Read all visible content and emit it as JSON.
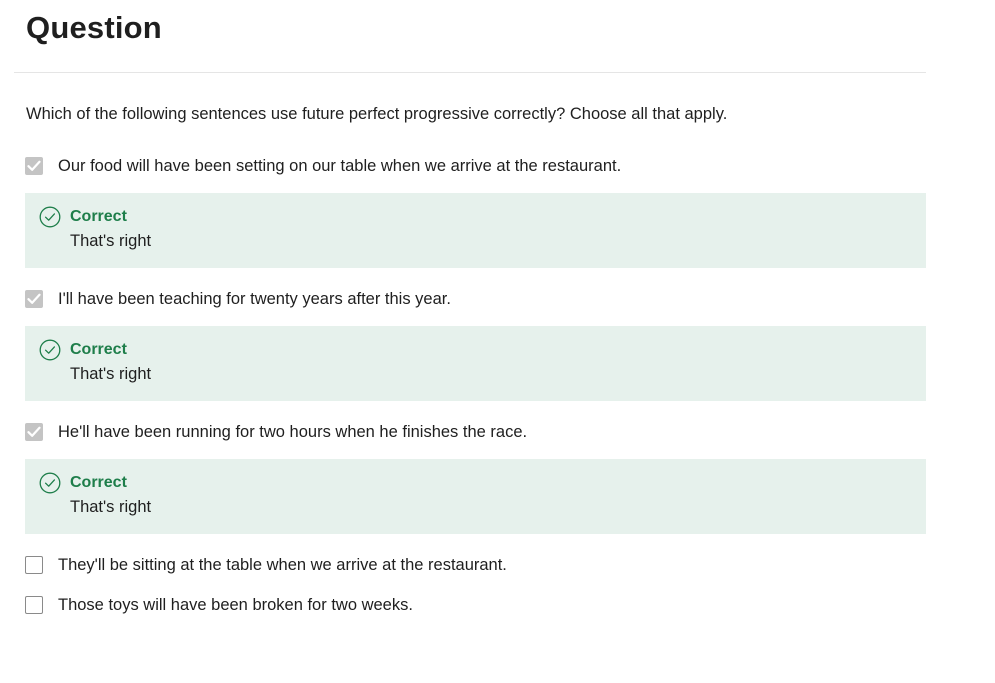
{
  "header": {
    "title": "Question"
  },
  "question": {
    "prompt": "Which of the following sentences use future perfect progressive correctly? Choose all that apply."
  },
  "options": [
    {
      "label": "Our food will have been setting on our table when we arrive at the restaurant.",
      "checked": true,
      "feedback": {
        "status": "Correct",
        "message": "That's right"
      }
    },
    {
      "label": "I'll have been teaching for twenty years after this year.",
      "checked": true,
      "feedback": {
        "status": "Correct",
        "message": "That's right"
      }
    },
    {
      "label": "He'll have been running for two hours when he finishes the race.",
      "checked": true,
      "feedback": {
        "status": "Correct",
        "message": "That's right"
      }
    },
    {
      "label": "They'll be sitting at the table when we arrive at the restaurant.",
      "checked": false
    },
    {
      "label": "Those toys will have been broken for two weeks.",
      "checked": false
    }
  ],
  "colors": {
    "correct_green": "#1e7e4a",
    "feedback_background": "#e6f1ec",
    "checked_box": "#c4c4c4"
  },
  "icons": {
    "check": "checkmark-icon",
    "feedback": "check-circle-icon"
  }
}
